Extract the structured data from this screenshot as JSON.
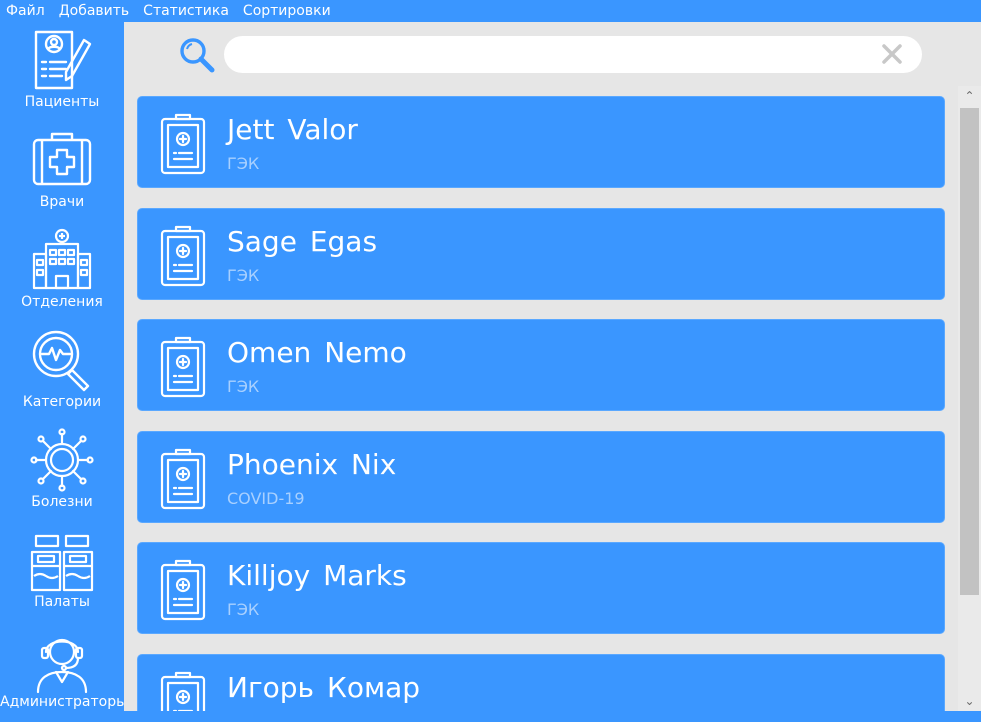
{
  "menu": [
    "Файл",
    "Добавить",
    "Статистика",
    "Сортировки"
  ],
  "sidebar": [
    {
      "label": "Пациенты",
      "icon": "patient-record-icon"
    },
    {
      "label": "Врачи",
      "icon": "medical-kit-icon"
    },
    {
      "label": "Отделения",
      "icon": "hospital-building-icon"
    },
    {
      "label": "Категории",
      "icon": "magnifier-pulse-icon"
    },
    {
      "label": "Болезни",
      "icon": "virus-icon"
    },
    {
      "label": "Палаты",
      "icon": "beds-icon"
    },
    {
      "label": "Администраторы",
      "icon": "admin-headset-icon"
    }
  ],
  "search": {
    "value": "",
    "placeholder": ""
  },
  "cards": [
    {
      "name": "Jett Valor",
      "diagnosis": "ГЭК"
    },
    {
      "name": "Sage Egas",
      "diagnosis": "ГЭК"
    },
    {
      "name": "Omen Nemo",
      "diagnosis": "ГЭК"
    },
    {
      "name": "Phoenix Nix",
      "diagnosis": "COVID-19"
    },
    {
      "name": "Killjoy Marks",
      "diagnosis": "ГЭК"
    },
    {
      "name": "Игорь Комар",
      "diagnosis": ""
    }
  ],
  "colors": {
    "accent": "#3a96ff",
    "background": "#e6e6e6",
    "subtext": "#a8d0ff"
  }
}
